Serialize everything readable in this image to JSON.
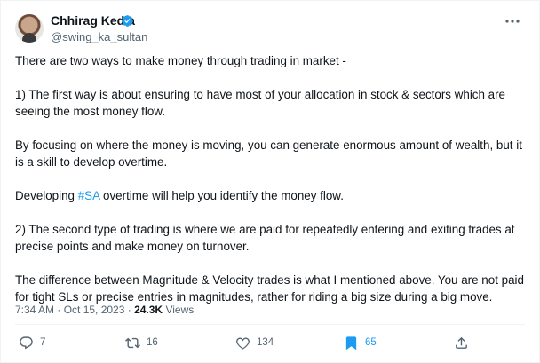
{
  "author": {
    "name": "Chhirag Kedia",
    "handle": "@swing_ka_sultan"
  },
  "tweet": {
    "paragraphs": [
      "There are two ways to make money through trading in market -",
      "1) The first way is about ensuring to have most of your allocation in stock & sectors which are seeing the most money flow.",
      "By focusing on where the money is moving, you can generate enormous amount of wealth, but it is a skill to develop overtime.",
      {
        "before": "Developing ",
        "hashtag": "#SA",
        "after": " overtime will help you identify the money flow."
      },
      "2) The second type of trading is where we are paid for repeatedly entering and exiting trades at precise points and make money on turnover.",
      "The difference between Magnitude & Velocity trades is what I mentioned above. You are not paid for tight SLs or precise entries in magnitudes, rather for riding a big size during a big move."
    ]
  },
  "meta": {
    "timestamp": "7:34 AM · Oct 15, 2023",
    "separator": " · ",
    "views_count": "24.3K",
    "views_label": " Views"
  },
  "actions": {
    "replies": "7",
    "retweets": "16",
    "likes": "134",
    "bookmarks": "65"
  },
  "colors": {
    "accent": "#1d9bf0",
    "text": "#0f1419",
    "muted": "#536471"
  }
}
